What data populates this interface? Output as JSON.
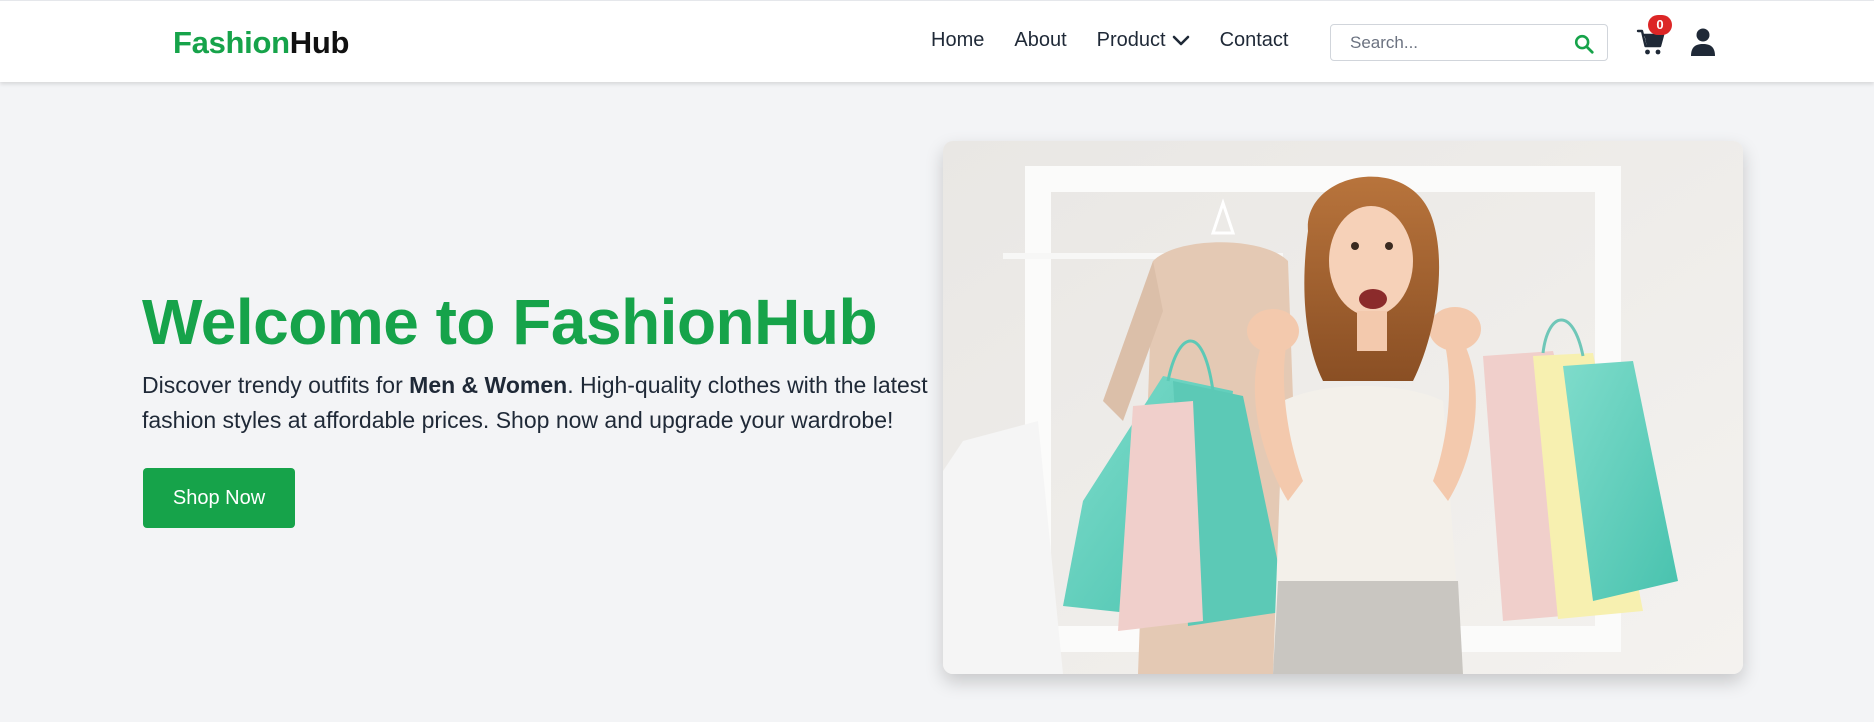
{
  "header": {
    "logo_part1": "Fashion",
    "logo_part2": "Hub",
    "nav": {
      "home": "Home",
      "about": "About",
      "product": "Product",
      "contact": "Contact"
    },
    "search_placeholder": "Search...",
    "search_value": "",
    "cart_count": "0"
  },
  "hero": {
    "title": "Welcome to FashionHub",
    "text_before": "Discover trendy outfits for ",
    "text_bold": "Men & Women",
    "text_after": ". High-quality clothes with the latest fashion styles at affordable prices. Shop now and upgrade your wardrobe!",
    "button_label": "Shop Now"
  },
  "colors": {
    "brand_green": "#16a34a",
    "badge_red": "#dc2626",
    "page_background": "#f3f4f6"
  },
  "icons": {
    "search": "search-icon",
    "product_dropdown": "chevron-down-icon",
    "cart": "cart-icon",
    "user": "user-icon"
  }
}
